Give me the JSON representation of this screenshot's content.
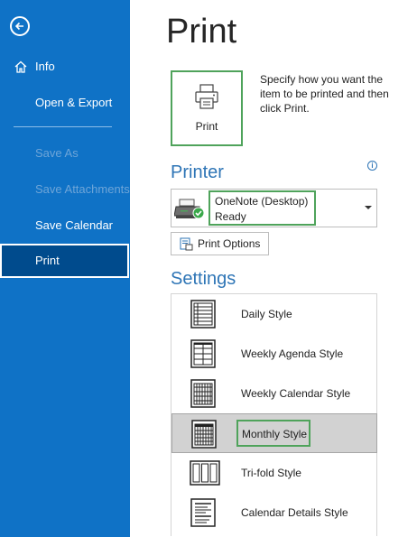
{
  "sidebar": {
    "back_icon": "back-arrow-icon",
    "items": [
      {
        "label": "Info",
        "icon": "home-icon",
        "state": "normal"
      },
      {
        "label": "Open & Export",
        "state": "normal"
      },
      {
        "label": "Save As",
        "state": "disabled"
      },
      {
        "label": "Save Attachments",
        "state": "disabled"
      },
      {
        "label": "Save Calendar",
        "state": "normal"
      },
      {
        "label": "Print",
        "state": "selected"
      }
    ],
    "background_color": "#0f72c6",
    "selected_color": "#004b8d"
  },
  "main": {
    "title": "Print",
    "print_button": {
      "label": "Print",
      "icon": "printer-icon"
    },
    "print_description": "Specify how you want the item to be printed and then click Print.",
    "printer_section": {
      "heading": "Printer",
      "info_icon": "info-icon",
      "selected_printer": {
        "name": "OneNote (Desktop)",
        "status": "Ready",
        "icon": "printer-ready-icon"
      },
      "options_button": {
        "label": "Print Options",
        "icon": "print-options-icon"
      }
    },
    "settings_section": {
      "heading": "Settings",
      "styles": [
        {
          "label": "Daily Style",
          "icon": "daily-style-icon",
          "selected": false
        },
        {
          "label": "Weekly Agenda Style",
          "icon": "weekly-agenda-style-icon",
          "selected": false
        },
        {
          "label": "Weekly Calendar Style",
          "icon": "weekly-calendar-style-icon",
          "selected": false
        },
        {
          "label": "Monthly Style",
          "icon": "monthly-style-icon",
          "selected": true
        },
        {
          "label": "Tri-fold Style",
          "icon": "trifold-style-icon",
          "selected": false
        },
        {
          "label": "Calendar Details Style",
          "icon": "calendar-details-style-icon",
          "selected": false
        }
      ]
    },
    "highlight_color": "#4fa35b",
    "heading_color": "#2e75b6"
  }
}
